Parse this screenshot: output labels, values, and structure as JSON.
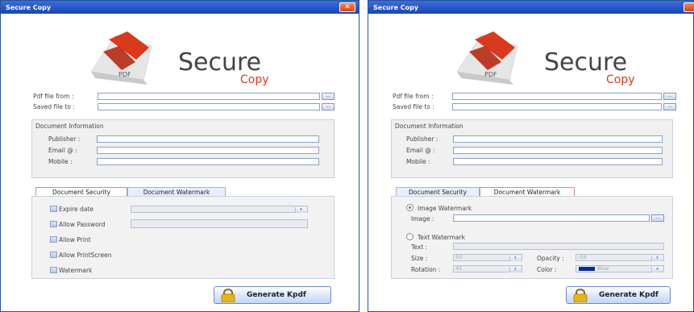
{
  "left_window": {
    "title": "Secure Copy",
    "close": "✕",
    "logo": {
      "word1": "Secure",
      "word2": "Copy",
      "badge": "PDF"
    },
    "pdf_from_label": "Pdf file from :",
    "saved_to_label": "Saved file to :",
    "browse_label": "...",
    "doc_info": {
      "title": "Document Information",
      "publisher_label": "Publisher :",
      "email_label": "Email @ :",
      "mobile_label": "Mobile :"
    },
    "tabs": {
      "security": "Document Security",
      "watermark": "Document Watermark"
    },
    "security": {
      "expire_label": "Expire date",
      "password_label": "Allow Password",
      "print_label": "Allow Print",
      "printscreen_label": "Allow PrintScreen",
      "watermark_label": "Watermark"
    },
    "generate_label": "Generate Kpdf"
  },
  "right_window": {
    "title": "Secure Copy",
    "logo": {
      "word1": "Secure",
      "word2": "Copy",
      "badge": "PDF"
    },
    "pdf_from_label": "Pdf file from :",
    "saved_to_label": "Saved file to :",
    "browse_label": "...",
    "doc_info": {
      "title": "Document Information",
      "publisher_label": "Publisher :",
      "email_label": "Email @ :",
      "mobile_label": "Mobile :"
    },
    "tabs": {
      "security": "Document Security",
      "watermark": "Document Watermark"
    },
    "watermark": {
      "image_radio_label": "Image Watermark",
      "image_label": "Image :",
      "text_radio_label": "Text Watermark",
      "text_label": "Text :",
      "size_label": "Size :",
      "size_value": "50",
      "opacity_label": "Opacity :",
      "opacity_value": ".03",
      "rotation_label": "Rotation :",
      "rotation_value": "45",
      "color_label": "Color :",
      "color_value": "Blue",
      "color_hex": "#0a2a9a"
    },
    "generate_label": "Generate Kpdf"
  },
  "colors": {
    "titlebar": "#1b45b3",
    "close": "#d5441c",
    "logo_red": "#d93a1e"
  }
}
